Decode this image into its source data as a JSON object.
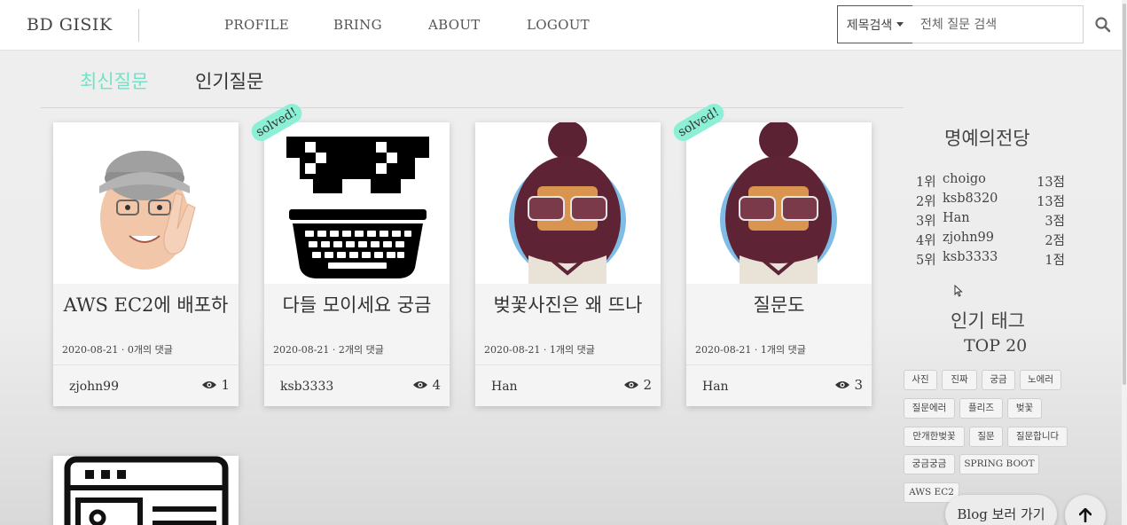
{
  "navbar": {
    "brand": "BD GISIK",
    "links": [
      "PROFILE",
      "BRING",
      "ABOUT",
      "LOGOUT"
    ],
    "search_type": "제목검색",
    "search_placeholder": "전체 질문 검색"
  },
  "tabs": {
    "latest": "최신질문",
    "popular": "인기질문"
  },
  "cards": [
    {
      "title": "AWS EC2에 배포하",
      "meta": "2020-08-21 · 0개의 댓글",
      "author": "zjohn99",
      "views": "1",
      "solved": false,
      "image": "memoji-avatar"
    },
    {
      "title": "다들 모이세요 궁금",
      "meta": "2020-08-21 · 2개의 댓글",
      "author": "ksb3333",
      "views": "4",
      "solved": true,
      "solved_label": "solved!",
      "image": "pixel-glasses-typewriter"
    },
    {
      "title": "벚꽃사진은 왜 뜨나",
      "meta": "2020-08-21 · 1개의 댓글",
      "author": "Han",
      "views": "2",
      "solved": false,
      "image": "bun-hair-avatar"
    },
    {
      "title": "질문도",
      "meta": "2020-08-21 · 1개의 댓글",
      "author": "Han",
      "views": "3",
      "solved": true,
      "solved_label": "solved!",
      "image": "bun-hair-avatar"
    }
  ],
  "sidebar": {
    "hall_of_fame_title": "명예의전당",
    "ranks": [
      {
        "pos": "1위",
        "name": "choigo",
        "score": "13점"
      },
      {
        "pos": "2위",
        "name": "ksb8320",
        "score": "13점"
      },
      {
        "pos": "3위",
        "name": "Han",
        "score": "3점"
      },
      {
        "pos": "4위",
        "name": "zjohn99",
        "score": "2점"
      },
      {
        "pos": "5위",
        "name": "ksb3333",
        "score": "1점"
      }
    ],
    "tags_title": "인기 태그",
    "tags_subtitle": "TOP 20",
    "tags": [
      "사진",
      "진짜",
      "궁금",
      "노에러",
      "질문에러",
      "플리즈",
      "벚꽃",
      "만개한벚꽃",
      "질문",
      "질문합니다",
      "궁금궁금",
      "SPRING BOOT",
      "AWS EC2"
    ]
  },
  "footer": {
    "blog_button": "Blog 보러 가기"
  },
  "colors": {
    "accent": "#6fe3c7",
    "solved_badge": "#8cf0d6"
  }
}
